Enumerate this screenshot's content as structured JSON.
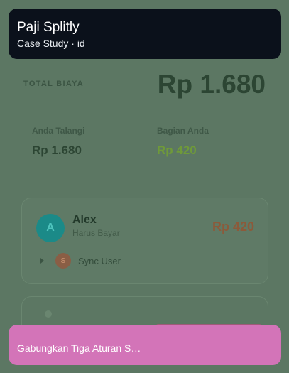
{
  "header": {
    "title": "Paji Splitly",
    "subtitle": "Case Study · id"
  },
  "summary": {
    "total_label": "TOTAL BIAYA",
    "total_amount": "Rp 1.680",
    "paid_label": "Anda Talangi",
    "paid_value": "Rp 1.680",
    "share_label": "Bagian Anda",
    "share_value": "Rp 420"
  },
  "person": {
    "initial": "A",
    "name": "Alex",
    "status": "Harus Bayar",
    "amount": "Rp 420",
    "sync_initial": "S",
    "sync_label": "Sync User"
  },
  "bottom_bar": {
    "text": "Gabungkan Tiga Aturan S…"
  },
  "colors": {
    "accent_green": "#6f9a39",
    "owed_brown": "#8c5a3a",
    "banner_pink": "#d374b8",
    "header_dark": "#0b111b"
  }
}
